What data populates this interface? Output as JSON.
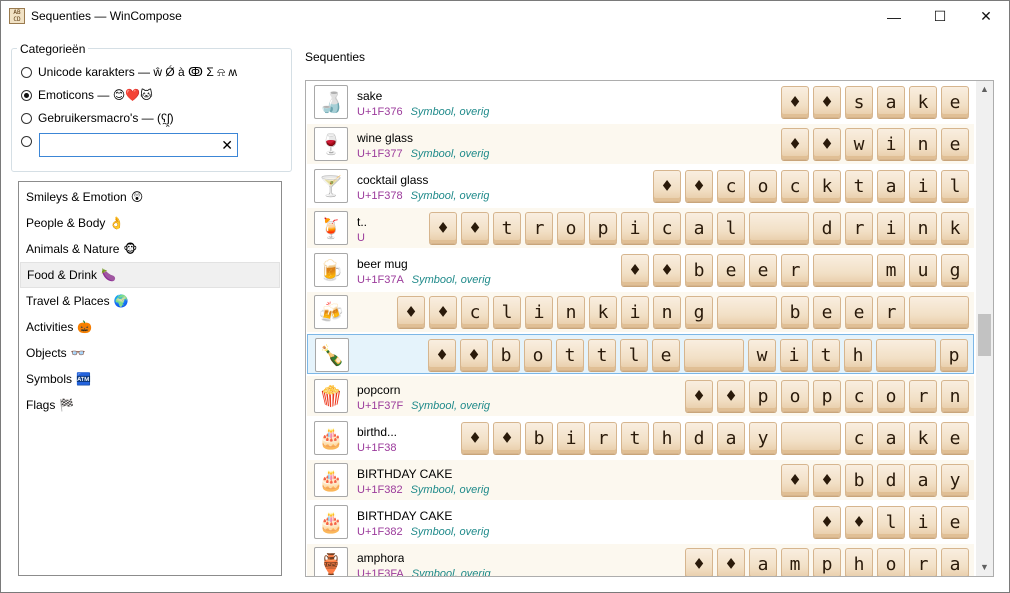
{
  "window": {
    "title": "Sequenties — WinCompose",
    "app_icon": "AB CD",
    "controls": {
      "minimize": "—",
      "maximize": "☐",
      "close": "✕"
    }
  },
  "categories": {
    "legend": "Categorieën",
    "options": [
      {
        "label": "Unicode karakters — ŵ Ǿ à ↂ Σ ⍾ ʍ",
        "selected": false
      },
      {
        "label": "Emoticons — 😊❤️🐱",
        "selected": true
      },
      {
        "label": "Gebruikersmacro's — (ʕ̯ʃ̯)",
        "selected": false
      }
    ],
    "macro_value": "",
    "clear_icon": "✕"
  },
  "subcategories": [
    {
      "label": "Smileys & Emotion",
      "emoji": "😲",
      "selected": false
    },
    {
      "label": "People & Body",
      "emoji": "👌",
      "selected": false
    },
    {
      "label": "Animals & Nature",
      "emoji": "🐵",
      "selected": false
    },
    {
      "label": "Food & Drink",
      "emoji": "🍆",
      "selected": true
    },
    {
      "label": "Travel & Places",
      "emoji": "🌍",
      "selected": false
    },
    {
      "label": "Activities",
      "emoji": "🎃",
      "selected": false
    },
    {
      "label": "Objects",
      "emoji": "👓",
      "selected": false
    },
    {
      "label": "Symbols",
      "emoji": "🏧",
      "selected": false
    },
    {
      "label": "Flags",
      "emoji": "🏁",
      "selected": false
    }
  ],
  "sequences_label": "Sequenties",
  "sequences": [
    {
      "emoji": "🍶",
      "name": "sake",
      "code": "U+1F376",
      "category": "Symbool, overig",
      "keys": [
        "♦",
        "♦",
        "s",
        "a",
        "k",
        "e"
      ]
    },
    {
      "emoji": "🍷",
      "name": "wine glass",
      "code": "U+1F377",
      "category": "Symbool, overig",
      "keys": [
        "♦",
        "♦",
        "w",
        "i",
        "n",
        "e"
      ]
    },
    {
      "emoji": "🍸",
      "name": "cocktail glass",
      "code": "U+1F378",
      "category": "Symbool, overig",
      "keys": [
        "♦",
        "♦",
        "c",
        "o",
        "c",
        "k",
        "t",
        "a",
        "i",
        "l"
      ]
    },
    {
      "emoji": "🍹",
      "name": "t..",
      "code": "U",
      "category": "",
      "keys": [
        "♦",
        "♦",
        "t",
        "r",
        "o",
        "p",
        "i",
        "c",
        "a",
        "l",
        " ",
        "d",
        "r",
        "i",
        "n",
        "k"
      ]
    },
    {
      "emoji": "🍺",
      "name": "beer mug",
      "code": "U+1F37A",
      "category": "Symbool, overig",
      "keys": [
        "♦",
        "♦",
        "b",
        "e",
        "e",
        "r",
        " ",
        "m",
        "u",
        "g"
      ]
    },
    {
      "emoji": "🍻",
      "name": "",
      "code": "",
      "category": "",
      "keys": [
        "♦",
        "♦",
        "c",
        "l",
        "i",
        "n",
        "k",
        "i",
        "n",
        "g",
        " ",
        "b",
        "e",
        "e",
        "r",
        " "
      ]
    },
    {
      "emoji": "🍾",
      "name": "",
      "code": "",
      "category": "",
      "keys": [
        "♦",
        "♦",
        "b",
        "o",
        "t",
        "t",
        "l",
        "e",
        " ",
        "w",
        "i",
        "t",
        "h",
        " ",
        "p"
      ]
    },
    {
      "emoji": "🍿",
      "name": "popcorn",
      "code": "U+1F37F",
      "category": "Symbool, overig",
      "keys": [
        "♦",
        "♦",
        "p",
        "o",
        "p",
        "c",
        "o",
        "r",
        "n"
      ]
    },
    {
      "emoji": "🎂",
      "name": "birthd...",
      "code": "U+1F38",
      "category": "",
      "keys": [
        "♦",
        "♦",
        "b",
        "i",
        "r",
        "t",
        "h",
        "d",
        "a",
        "y",
        " ",
        "c",
        "a",
        "k",
        "e"
      ]
    },
    {
      "emoji": "🎂",
      "name": "BIRTHDAY CAKE",
      "code": "U+1F382",
      "category": "Symbool, overig",
      "keys": [
        "♦",
        "♦",
        "b",
        "d",
        "a",
        "y"
      ]
    },
    {
      "emoji": "🎂",
      "name": "BIRTHDAY CAKE",
      "code": "U+1F382",
      "category": "Symbool, overig",
      "keys": [
        "♦",
        "♦",
        "l",
        "i",
        "e"
      ]
    },
    {
      "emoji": "🏺",
      "name": "amphora",
      "code": "U+1F3FA",
      "category": "Symbool, overig",
      "keys": [
        "♦",
        "♦",
        "a",
        "m",
        "p",
        "h",
        "o",
        "r",
        "a"
      ]
    }
  ],
  "scroll": {
    "up": "▲",
    "down": "▼"
  }
}
